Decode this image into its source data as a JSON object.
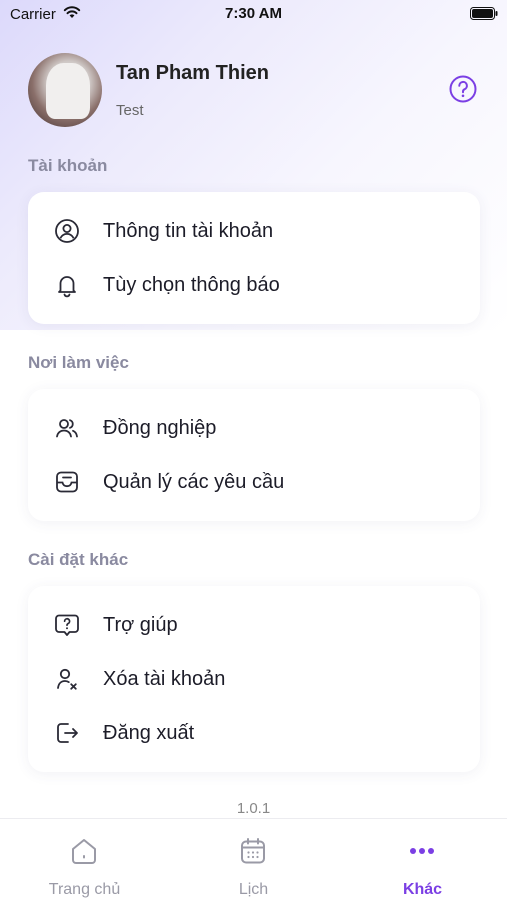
{
  "status_bar": {
    "carrier": "Carrier",
    "time": "7:30 AM"
  },
  "profile": {
    "name": "Tan Pham Thien",
    "subtitle": "Test"
  },
  "sections": {
    "account": {
      "title": "Tài khoản",
      "items": [
        {
          "label": "Thông tin tài khoản",
          "icon": "user-circle-icon"
        },
        {
          "label": "Tùy chọn thông báo",
          "icon": "bell-icon"
        }
      ]
    },
    "workplace": {
      "title": "Nơi làm việc",
      "items": [
        {
          "label": "Đồng nghiệp",
          "icon": "users-icon"
        },
        {
          "label": "Quản lý các yêu cầu",
          "icon": "inbox-icon"
        }
      ]
    },
    "other": {
      "title": "Cài đặt khác",
      "items": [
        {
          "label": "Trợ giúp",
          "icon": "help-chat-icon"
        },
        {
          "label": "Xóa tài khoản",
          "icon": "user-remove-icon"
        },
        {
          "label": "Đăng xuất",
          "icon": "logout-icon"
        }
      ]
    }
  },
  "version": "1.0.1",
  "tab_bar": {
    "tabs": [
      {
        "label": "Trang chủ",
        "icon": "home-icon",
        "active": false
      },
      {
        "label": "Lịch",
        "icon": "calendar-icon",
        "active": false
      },
      {
        "label": "Khác",
        "icon": "more-icon",
        "active": true
      }
    ]
  },
  "colors": {
    "accent": "#7b3fe4",
    "section_title": "#8a8aa0",
    "inactive_tab": "#9a9aa6"
  }
}
